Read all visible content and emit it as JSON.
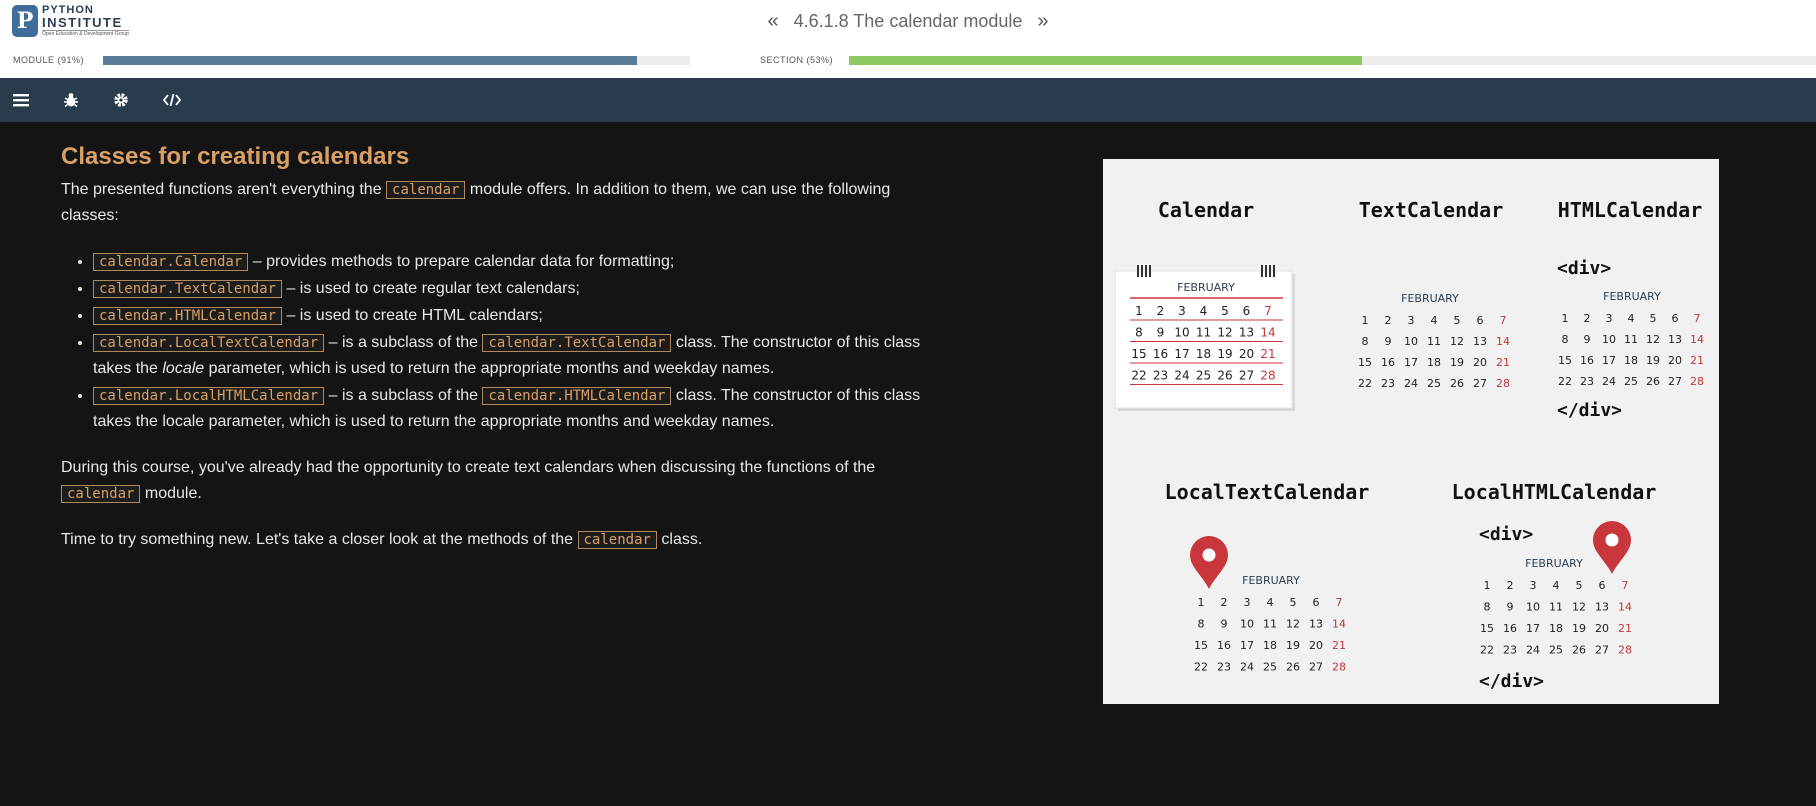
{
  "header": {
    "logo_line1": "PYTHON",
    "logo_line2": "INSTITUTE",
    "logo_line3": "Open Education & Development Group",
    "prev_icon": "double-chevron-left-icon",
    "title": "4.6.1.8 The calendar module",
    "next_icon": "double-chevron-right-icon"
  },
  "progress": {
    "module_label": "MODULE (91%)",
    "module_value": 0.91,
    "module_color": "#5a7b99",
    "section_label": "SECTION (53%)",
    "section_value": 0.53,
    "section_color": "#8cc95e"
  },
  "toolbar": {
    "icons": [
      "menu-icon",
      "bug-icon",
      "gear-icon",
      "code-icon"
    ]
  },
  "content": {
    "heading": "Classes for creating calendars",
    "intro_before": "The presented functions aren't everything the ",
    "intro_code": "calendar",
    "intro_after": " module offers. In addition to them, we can use the following classes:",
    "list": [
      {
        "code": "calendar.Calendar",
        "text": " – provides methods to prepare calendar data for formatting;"
      },
      {
        "code": "calendar.TextCalendar",
        "text": " – is used to create regular text calendars;"
      },
      {
        "code": "calendar.HTMLCalendar",
        "text": " – is used to create HTML calendars;"
      },
      {
        "code": "calendar.LocalTextCalendar",
        "text_a": " – is a subclass of the ",
        "code2": "calendar.TextCalendar",
        "text_b": " class. The constructor of this class takes the ",
        "em": "locale",
        "text_c": " parameter, which is used to return the appropriate months and weekday names."
      },
      {
        "code": "calendar.LocalHTMLCalendar",
        "text_a": " – is a subclass of the ",
        "code2": "calendar.HTMLCalendar",
        "text_b": " class. The constructor of this class takes the locale parameter, which is used to return the appropriate months and weekday names."
      }
    ],
    "para2_before": "During this course, you've already had the opportunity to create text calendars when discussing the functions of the ",
    "para2_code": "calendar",
    "para2_after": " module.",
    "para3_before": "Time to try something new. Let's take a closer look at the methods of the ",
    "para3_code": "calendar",
    "para3_after": " class."
  },
  "illustration": {
    "titles": [
      "Calendar",
      "TextCalendar",
      "HTMLCalendar",
      "LocalTextCalendar",
      "LocalHTMLCalendar"
    ],
    "month": "FEBRUARY",
    "div_open": "<div>",
    "div_close": "</div>",
    "weeks": [
      [
        "1",
        "2",
        "3",
        "4",
        "5",
        "6",
        "7"
      ],
      [
        "8",
        "9",
        "10",
        "11",
        "12",
        "13",
        "14"
      ],
      [
        "15",
        "16",
        "17",
        "18",
        "19",
        "20",
        "21"
      ],
      [
        "22",
        "23",
        "24",
        "25",
        "26",
        "27",
        "28"
      ]
    ],
    "weekend_color": "#c0393b",
    "pin_color": "#c9363b"
  }
}
